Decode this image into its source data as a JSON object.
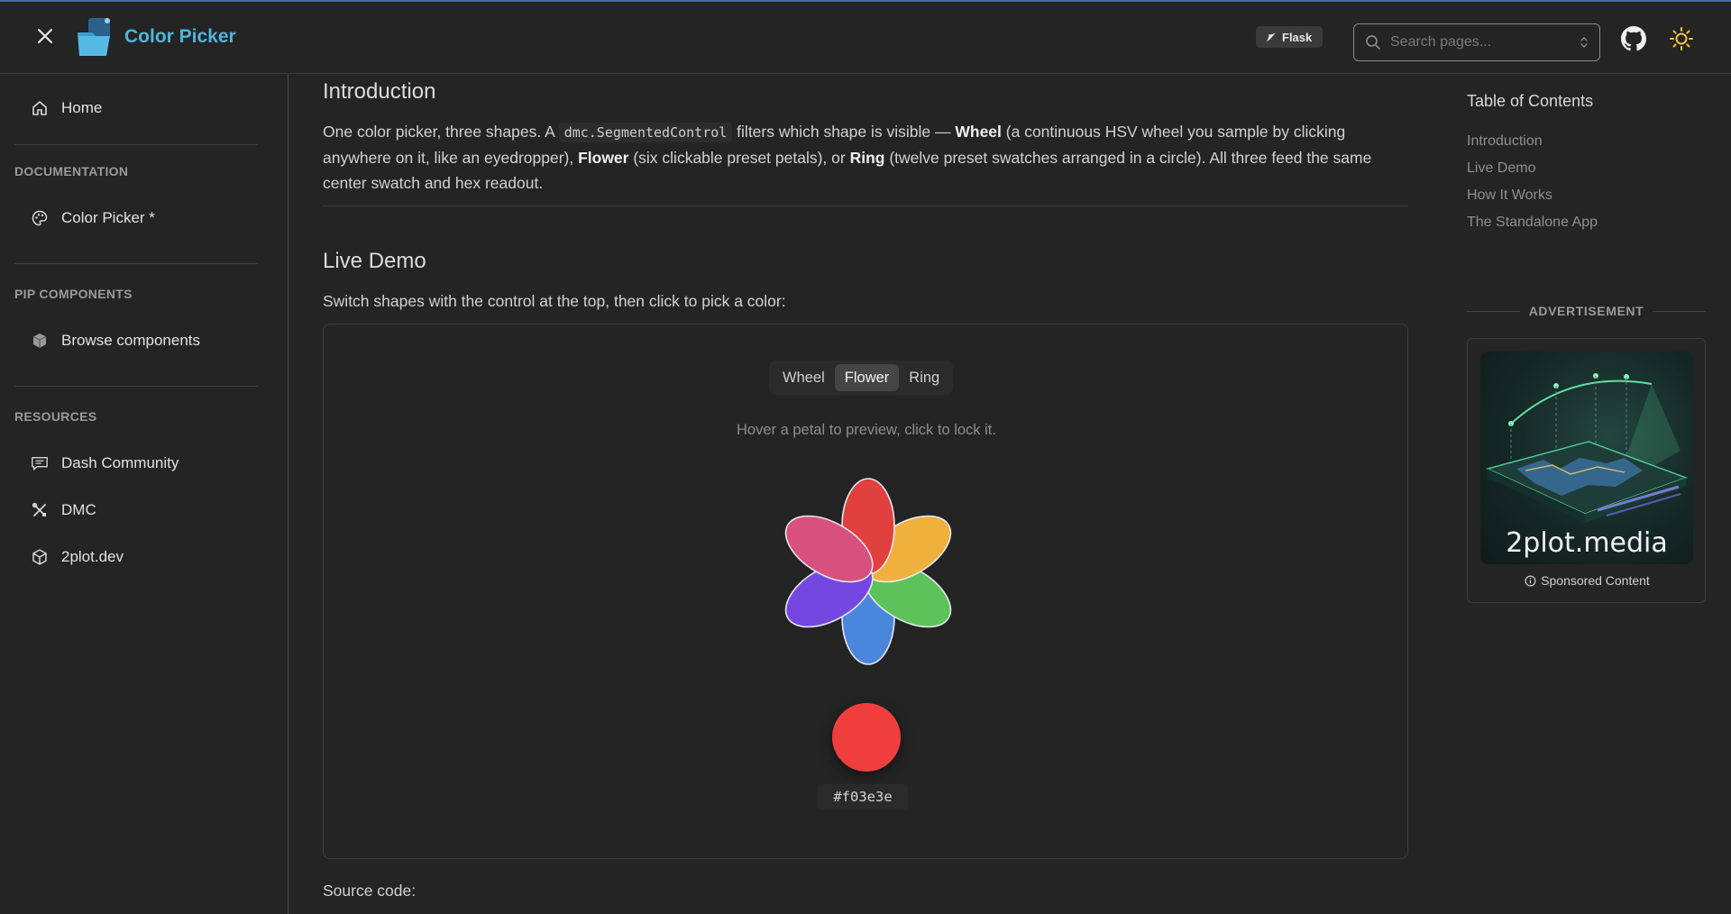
{
  "header": {
    "app_title": "Color Picker",
    "badge": "Flask",
    "search_placeholder": "Search pages..."
  },
  "sidebar": {
    "home": "Home",
    "sections": [
      {
        "label": "DOCUMENTATION",
        "items": [
          "Color Picker *"
        ]
      },
      {
        "label": "PIP COMPONENTS",
        "items": [
          "Browse components"
        ]
      },
      {
        "label": "RESOURCES",
        "items": [
          "Dash Community",
          "DMC",
          "2plot.dev"
        ]
      }
    ]
  },
  "main": {
    "intro_heading": "Introduction",
    "intro": {
      "p1": "One color picker, three shapes. A ",
      "code": "dmc.SegmentedControl",
      "p2": " filters which shape is visible — ",
      "b1": "Wheel",
      "p3": " (a continuous HSV wheel you sample by clicking anywhere on it, like an eyedropper), ",
      "b2": "Flower",
      "p4": " (six clickable preset petals), or ",
      "b3": "Ring",
      "p5": " (twelve preset swatches arranged in a circle). All three feed the same center swatch and hex readout."
    },
    "live_heading": "Live Demo",
    "live_sub": "Switch shapes with the control at the top, then click to pick a color:",
    "segments": [
      "Wheel",
      "Flower",
      "Ring"
    ],
    "active_segment": "Flower",
    "hint": "Hover a petal to preview, click to lock it.",
    "petal_colors": [
      "#e0403e",
      "#f0b03c",
      "#5cc25a",
      "#4a86dc",
      "#7448e0",
      "#d8507e"
    ],
    "selected_color": "#f03e3e",
    "hex_readout": "#f03e3e",
    "source_label": "Source code:"
  },
  "toc": {
    "title": "Table of Contents",
    "links": [
      "Introduction",
      "Live Demo",
      "How It Works",
      "The Standalone App"
    ]
  },
  "ad": {
    "label": "ADVERTISEMENT",
    "brand": "2plot.media",
    "footer": "Sponsored Content"
  },
  "colors": {
    "accent": "#4fb5d9",
    "background": "#242424"
  }
}
